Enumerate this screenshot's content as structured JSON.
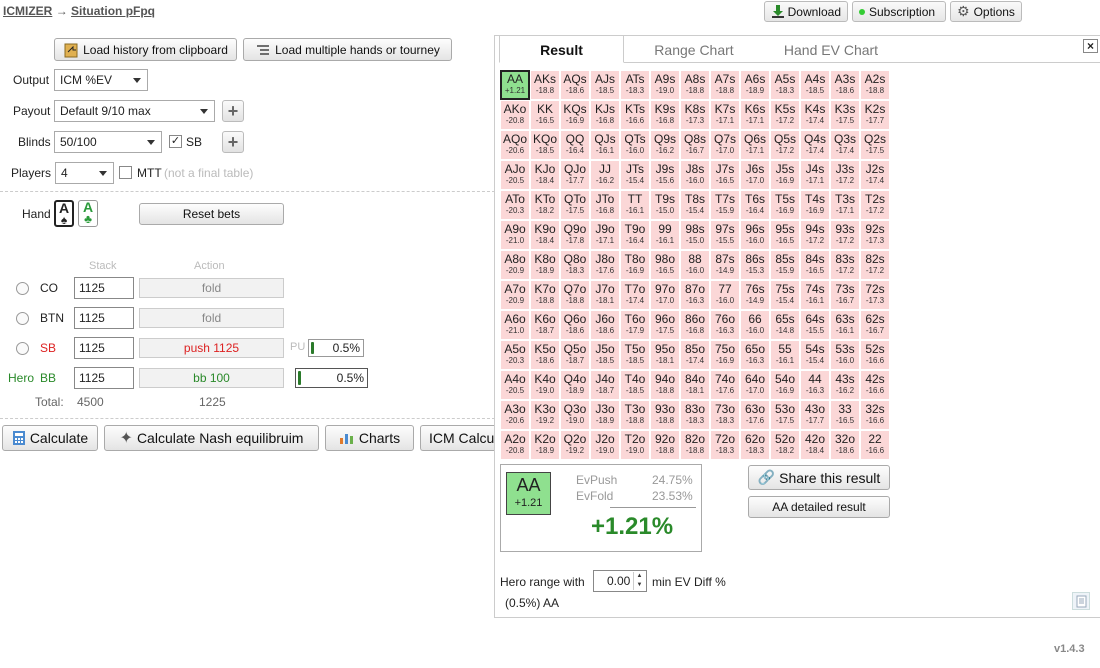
{
  "breadcrumb": {
    "app": "ICMIZER",
    "arrow": "→",
    "page": "Situation pFpq"
  },
  "topbar": {
    "download": "Download",
    "subscription": "Subscription",
    "options": "Options"
  },
  "load": {
    "history": "Load history from clipboard",
    "multiple": "Load multiple hands or tourney"
  },
  "settings": {
    "output_label": "Output",
    "output_value": "ICM %EV",
    "payout_label": "Payout",
    "payout_value": "Default 9/10 max",
    "blinds_label": "Blinds",
    "blinds_value": "50/100",
    "sb_label": "SB",
    "players_label": "Players",
    "players_value": "4",
    "mtt_label": "MTT",
    "mtt_note": "(not a final table)"
  },
  "hand": {
    "label": "Hand",
    "card1": "A",
    "card2": "A",
    "reset": "Reset bets"
  },
  "table": {
    "stack_header": "Stack",
    "action_header": "Action",
    "rows": [
      {
        "pos": "CO",
        "stack": "1125",
        "action": "fold"
      },
      {
        "pos": "BTN",
        "stack": "1125",
        "action": "fold"
      },
      {
        "pos": "SB",
        "stack": "1125",
        "action": "push 1125",
        "pu_label": "PU",
        "pu_value": "0.5%"
      },
      {
        "hero": "Hero",
        "pos": "BB",
        "stack": "1125",
        "action": "bb 100",
        "value": "0.5%"
      }
    ],
    "total_label": "Total:",
    "total_stack": "4500",
    "total_action": "1225"
  },
  "actions": {
    "calculate": "Calculate",
    "nash": "Calculate Nash equilibruim",
    "charts": "Charts",
    "icm": "ICM Calcu"
  },
  "tabs": {
    "result": "Result",
    "range": "Range Chart",
    "handev": "Hand EV Chart"
  },
  "close": "×",
  "grid": {
    "hands": [
      [
        "AA",
        "AKs",
        "AQs",
        "AJs",
        "ATs",
        "A9s",
        "A8s",
        "A7s",
        "A6s",
        "A5s",
        "A4s",
        "A3s",
        "A2s"
      ],
      [
        "AKo",
        "KK",
        "KQs",
        "KJs",
        "KTs",
        "K9s",
        "K8s",
        "K7s",
        "K6s",
        "K5s",
        "K4s",
        "K3s",
        "K2s"
      ],
      [
        "AQo",
        "KQo",
        "QQ",
        "QJs",
        "QTs",
        "Q9s",
        "Q8s",
        "Q7s",
        "Q6s",
        "Q5s",
        "Q4s",
        "Q3s",
        "Q2s"
      ],
      [
        "AJo",
        "KJo",
        "QJo",
        "JJ",
        "JTs",
        "J9s",
        "J8s",
        "J7s",
        "J6s",
        "J5s",
        "J4s",
        "J3s",
        "J2s"
      ],
      [
        "ATo",
        "KTo",
        "QTo",
        "JTo",
        "TT",
        "T9s",
        "T8s",
        "T7s",
        "T6s",
        "T5s",
        "T4s",
        "T3s",
        "T2s"
      ],
      [
        "A9o",
        "K9o",
        "Q9o",
        "J9o",
        "T9o",
        "99",
        "98s",
        "97s",
        "96s",
        "95s",
        "94s",
        "93s",
        "92s"
      ],
      [
        "A8o",
        "K8o",
        "Q8o",
        "J8o",
        "T8o",
        "98o",
        "88",
        "87s",
        "86s",
        "85s",
        "84s",
        "83s",
        "82s"
      ],
      [
        "A7o",
        "K7o",
        "Q7o",
        "J7o",
        "T7o",
        "97o",
        "87o",
        "77",
        "76s",
        "75s",
        "74s",
        "73s",
        "72s"
      ],
      [
        "A6o",
        "K6o",
        "Q6o",
        "J6o",
        "T6o",
        "96o",
        "86o",
        "76o",
        "66",
        "65s",
        "64s",
        "63s",
        "62s"
      ],
      [
        "A5o",
        "K5o",
        "Q5o",
        "J5o",
        "T5o",
        "95o",
        "85o",
        "75o",
        "65o",
        "55",
        "54s",
        "53s",
        "52s"
      ],
      [
        "A4o",
        "K4o",
        "Q4o",
        "J4o",
        "T4o",
        "94o",
        "84o",
        "74o",
        "64o",
        "54o",
        "44",
        "43s",
        "42s"
      ],
      [
        "A3o",
        "K3o",
        "Q3o",
        "J3o",
        "T3o",
        "93o",
        "83o",
        "73o",
        "63o",
        "53o",
        "43o",
        "33",
        "32s"
      ],
      [
        "A2o",
        "K2o",
        "Q2o",
        "J2o",
        "T2o",
        "92o",
        "82o",
        "72o",
        "62o",
        "52o",
        "42o",
        "32o",
        "22"
      ]
    ],
    "values": [
      [
        "+1.21",
        "-18.8",
        "-18.6",
        "-18.5",
        "-18.3",
        "-19.0",
        "-18.8",
        "-18.8",
        "-18.9",
        "-18.3",
        "-18.5",
        "-18.6",
        "-18.8"
      ],
      [
        "-20.8",
        "-16.5",
        "-16.9",
        "-16.8",
        "-16.6",
        "-16.8",
        "-17.3",
        "-17.1",
        "-17.1",
        "-17.2",
        "-17.4",
        "-17.5",
        "-17.7"
      ],
      [
        "-20.6",
        "-18.5",
        "-16.4",
        "-16.1",
        "-16.0",
        "-16.2",
        "-16.7",
        "-17.0",
        "-17.1",
        "-17.2",
        "-17.4",
        "-17.4",
        "-17.5"
      ],
      [
        "-20.5",
        "-18.4",
        "-17.7",
        "-16.2",
        "-15.4",
        "-15.6",
        "-16.0",
        "-16.5",
        "-17.0",
        "-16.9",
        "-17.1",
        "-17.2",
        "-17.4"
      ],
      [
        "-20.3",
        "-18.2",
        "-17.5",
        "-16.8",
        "-16.1",
        "-15.0",
        "-15.4",
        "-15.9",
        "-16.4",
        "-16.9",
        "-16.9",
        "-17.1",
        "-17.2"
      ],
      [
        "-21.0",
        "-18.4",
        "-17.8",
        "-17.1",
        "-16.4",
        "-16.1",
        "-15.0",
        "-15.5",
        "-16.0",
        "-16.5",
        "-17.2",
        "-17.2",
        "-17.3"
      ],
      [
        "-20.9",
        "-18.9",
        "-18.3",
        "-17.6",
        "-16.9",
        "-16.5",
        "-16.0",
        "-14.9",
        "-15.3",
        "-15.9",
        "-16.5",
        "-17.2",
        "-17.2"
      ],
      [
        "-20.9",
        "-18.8",
        "-18.8",
        "-18.1",
        "-17.4",
        "-17.0",
        "-16.3",
        "-16.0",
        "-14.9",
        "-15.4",
        "-16.1",
        "-16.7",
        "-17.3"
      ],
      [
        "-21.0",
        "-18.7",
        "-18.6",
        "-18.6",
        "-17.9",
        "-17.5",
        "-16.8",
        "-16.3",
        "-16.0",
        "-14.8",
        "-15.5",
        "-16.1",
        "-16.7"
      ],
      [
        "-20.3",
        "-18.6",
        "-18.7",
        "-18.5",
        "-18.5",
        "-18.1",
        "-17.4",
        "-16.9",
        "-16.3",
        "-16.1",
        "-15.4",
        "-16.0",
        "-16.6"
      ],
      [
        "-20.5",
        "-19.0",
        "-18.9",
        "-18.7",
        "-18.5",
        "-18.8",
        "-18.1",
        "-17.6",
        "-17.0",
        "-16.9",
        "-16.3",
        "-16.2",
        "-16.6"
      ],
      [
        "-20.6",
        "-19.2",
        "-19.0",
        "-18.9",
        "-18.8",
        "-18.8",
        "-18.3",
        "-18.3",
        "-17.6",
        "-17.5",
        "-17.7",
        "-16.5",
        "-16.6"
      ],
      [
        "-20.8",
        "-18.9",
        "-19.2",
        "-19.0",
        "-19.0",
        "-18.8",
        "-18.8",
        "-18.3",
        "-18.3",
        "-18.2",
        "-18.4",
        "-18.6",
        "-16.6"
      ]
    ]
  },
  "result": {
    "hand": "AA",
    "hand_ev": "+1.21",
    "evpush_label": "EvPush",
    "evpush_value": "24.75%",
    "evfold_label": "EvFold",
    "evfold_value": "23.53%",
    "diff": "+1.21%",
    "share": "Share this result",
    "detailed": "AA detailed result"
  },
  "hero_range": {
    "label": "Hero range with",
    "value": "0.00",
    "suffix": "min EV Diff %",
    "summary": "(0.5%) AA"
  },
  "version": "v1.4.3"
}
